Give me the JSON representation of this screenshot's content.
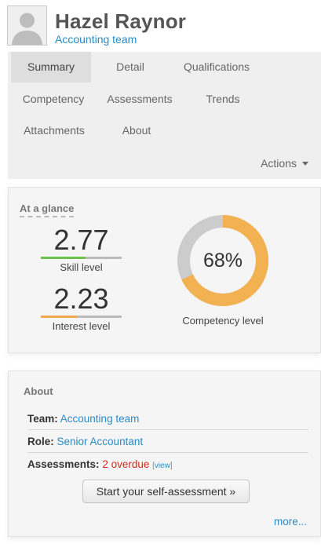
{
  "user": {
    "name": "Hazel Raynor",
    "team": "Accounting team"
  },
  "nav": {
    "tabs": [
      {
        "label": "Summary",
        "active": true
      },
      {
        "label": "Detail"
      },
      {
        "label": "Qualifications"
      },
      {
        "label": "Competency"
      },
      {
        "label": "Assessments"
      },
      {
        "label": "Trends"
      },
      {
        "label": "Attachments"
      },
      {
        "label": "About"
      }
    ],
    "actions_label": "Actions"
  },
  "glance": {
    "title": "At a glance",
    "skill": {
      "value": "2.77",
      "label": "Skill level",
      "bar_color": "#6cc24a",
      "bar_fraction": 0.55
    },
    "interest": {
      "value": "2.23",
      "label": "Interest level",
      "bar_color": "#f0a94f",
      "bar_fraction": 0.45
    },
    "competency": {
      "percent_text": "68%",
      "percent": 68,
      "label": "Competency level",
      "color": "#f2b252",
      "track_color": "#cccccc"
    }
  },
  "about": {
    "title": "About",
    "team_key": "Team:",
    "team_value": "Accounting team",
    "role_key": "Role:",
    "role_value": "Senior Accountant",
    "assessments_key": "Assessments:",
    "assessments_overdue": "2 overdue",
    "view_label": "view",
    "self_assessment_button": "Start your self-assessment »",
    "more_link": "more..."
  },
  "colors": {
    "link": "#2a8ac4",
    "overdue": "#d9261c",
    "panel_bg": "#efefef"
  },
  "icons": {
    "avatar": "user-silhouette-icon",
    "actions": "caret-down-icon"
  }
}
